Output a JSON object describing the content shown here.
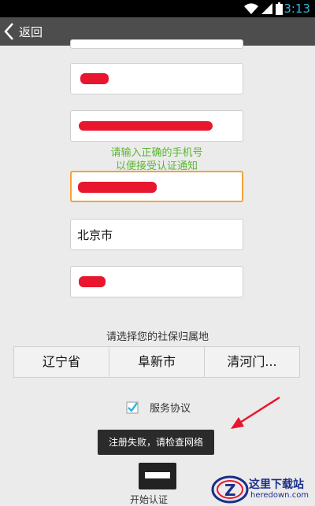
{
  "status_bar": {
    "time": "3:13"
  },
  "action_bar": {
    "back_label": "返回"
  },
  "form": {
    "name_field": "",
    "phone_hint_line1": "请输入正确的手机号",
    "phone_hint_line2": "以便接受认证通知",
    "city_field": "北京市"
  },
  "region": {
    "label": "请选择您的社保归属地",
    "options": [
      "辽宁省",
      "阜新市",
      "清河门..."
    ]
  },
  "agreement": {
    "label": "服务协议",
    "checked": true
  },
  "toast": "注册失败，请检查网络",
  "start_button": {
    "label": "开始认证"
  },
  "watermark": {
    "title": "这里下载站",
    "sub": "heredown.com"
  },
  "colors": {
    "accent": "#33b5e5",
    "hint": "#5cb531",
    "focus": "#f0a33a",
    "redaction": "#e8162e"
  }
}
